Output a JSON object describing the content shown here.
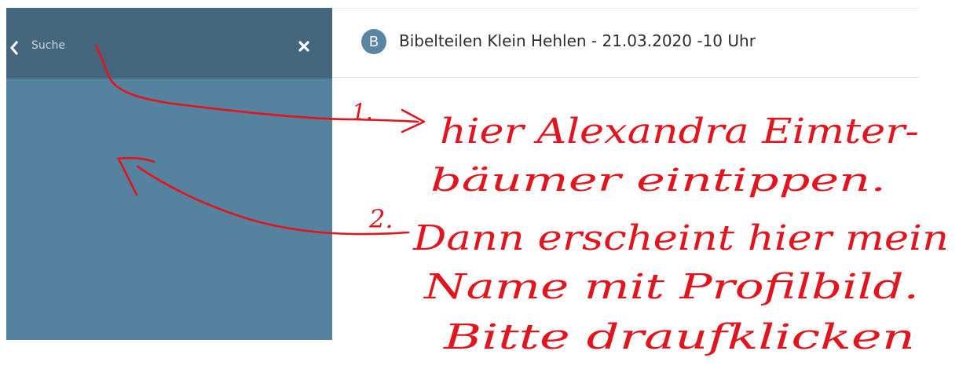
{
  "colors": {
    "panel_bg": "#55829e",
    "panel_header_bg": "#45677e",
    "avatar_bg": "#5a85a3",
    "annotation_red": "#e0151d"
  },
  "search": {
    "placeholder": "Suche",
    "value": "",
    "back_icon": "chevron-left-icon",
    "clear_icon": "close-icon"
  },
  "chat": {
    "avatar_letter": "B",
    "title": "Bibelteilen Klein Hehlen - 21.03.2020 -10 Uhr"
  },
  "annotations": {
    "step1_marker": "1.",
    "step1_line1": "hier Alexandra Eimter-",
    "step1_line2": "bäumer eintippen.",
    "step2_marker": "2.",
    "step2_line1": "Dann erscheint hier mein",
    "step2_line2": "Name mit Profilbild.",
    "step2_line3": "Bitte draufklicken"
  }
}
